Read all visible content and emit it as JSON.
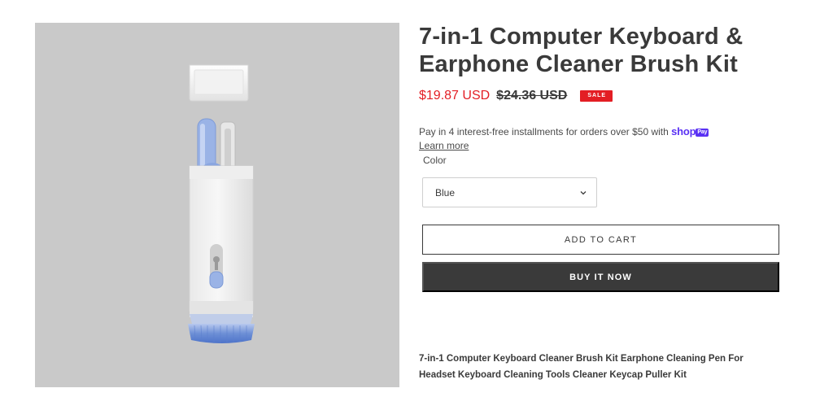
{
  "product": {
    "title_line1": "7-in-1 Computer Keyboard &",
    "title_line2": "Earphone Cleaner Brush Kit",
    "price_sale": "$19.87 USD",
    "price_regular": "$24.36 USD",
    "sale_badge": "SALE",
    "image_alt": "7-in-1 cleaner brush kit, blue"
  },
  "installments": {
    "text": "Pay in 4 interest-free installments for orders over $50 with",
    "shop_logo": "shop",
    "pay_badge": "Pay",
    "learn_more": "Learn more"
  },
  "variant": {
    "label": "Color",
    "selected": "Blue"
  },
  "actions": {
    "add_to_cart": "ADD TO CART",
    "buy_now": "BUY IT NOW"
  },
  "description": {
    "line1": "7-in-1 Computer Keyboard Cleaner Brush Kit Earphone Cleaning Pen For",
    "line2": "Headset Keyboard Cleaning Tools Cleaner Keycap Puller Kit"
  },
  "colors": {
    "sale_red": "#e31e24",
    "text_dark": "#3a3a3a",
    "shop_purple": "#5a31f4",
    "image_bg": "#c9c9c9",
    "brush_blue": "#6d8fd6"
  }
}
